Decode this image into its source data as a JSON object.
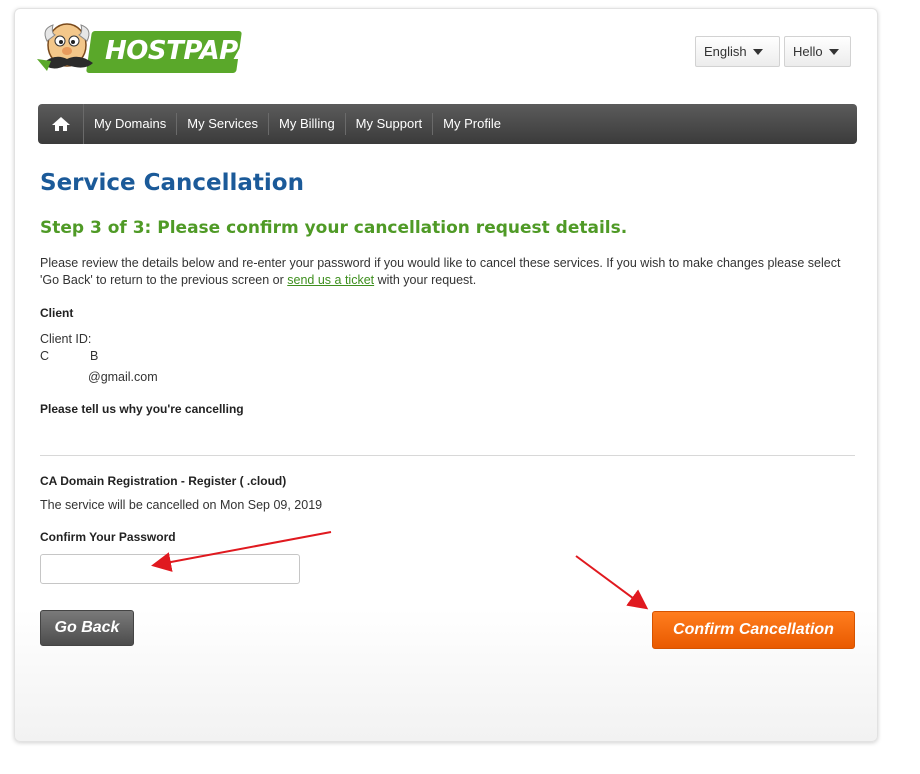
{
  "brand": {
    "logo_text": "HOSTPAPA",
    "green": "#5aa82a"
  },
  "header": {
    "language_label": "English",
    "user_label": "Hello"
  },
  "nav": {
    "home_icon": "home-icon",
    "items": [
      "My Domains",
      "My Services",
      "My Billing",
      "My Support",
      "My Profile"
    ]
  },
  "page": {
    "title": "Service Cancellation",
    "step_heading": "Step 3 of 3: Please confirm your cancellation request details.",
    "intro_before_link": "Please review the details below and re-enter your password if you would like to cancel these services. If you wish to make changes please select 'Go Back' to return to the previous screen or ",
    "intro_link": "send us a ticket",
    "intro_after_link": " with your request."
  },
  "client": {
    "section_label": "Client",
    "client_id_label": "Client ID:",
    "name_first_initial": "C",
    "name_last_initial": "B",
    "email": "@gmail.com"
  },
  "reason": {
    "label": "Please tell us why you're cancelling"
  },
  "service": {
    "name": "CA Domain Registration - Register (         .cloud)",
    "cancel_notice": "The service will be cancelled on Mon Sep 09, 2019"
  },
  "password": {
    "label": "Confirm Your Password",
    "value": "",
    "placeholder": ""
  },
  "actions": {
    "go_back_label": "Go Back",
    "confirm_label": "Confirm Cancellation"
  },
  "colors": {
    "title_blue": "#1b5a99",
    "step_green": "#4f9a26",
    "confirm_orange": "#f26b0f",
    "annotation_red": "#e0191f"
  }
}
